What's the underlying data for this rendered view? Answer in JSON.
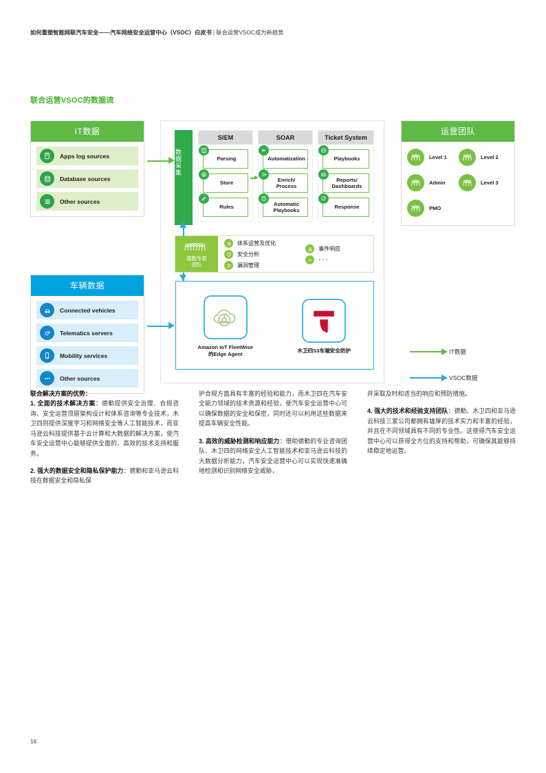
{
  "header": {
    "title_bold": "如何重塑智能网联汽车安全——汽车网络安全运营中心（VSOC）白皮书",
    "separator": "|",
    "subtitle": "联合运营VSOC成为新趋势"
  },
  "section_title": "联合运营VSOC的数据流",
  "diagram": {
    "it_panel": {
      "title": "IT数据",
      "items": [
        {
          "label": "Apps log sources",
          "icon": "device-icon"
        },
        {
          "label": "Database sources",
          "icon": "database-icon"
        },
        {
          "label": "Other sources",
          "icon": "list-icon"
        }
      ]
    },
    "vehicle_panel": {
      "title": "车辆数据",
      "items": [
        {
          "label": "Connected vehicles",
          "icon": "car-icon"
        },
        {
          "label": "Telematics servers",
          "icon": "satellite-icon"
        },
        {
          "label": "Mobility services",
          "icon": "mobile-icon"
        },
        {
          "label": "Other sources",
          "icon": "ellipsis-icon"
        }
      ]
    },
    "ops_panel": {
      "title": "运营团队",
      "members": [
        {
          "label": "Level 1",
          "icon": "people-icon"
        },
        {
          "label": "Level 2",
          "icon": "people-icon"
        },
        {
          "label": "Admin",
          "icon": "people-icon"
        },
        {
          "label": "Level 3",
          "icon": "people-icon"
        },
        {
          "label": "PMO",
          "icon": "people-icon"
        }
      ]
    },
    "collection_bar": "数据采集",
    "tool_columns": [
      {
        "head": "SIEM",
        "items": [
          {
            "label": "Parsing",
            "icon": "parse-icon"
          },
          {
            "label": "Store",
            "icon": "store-icon"
          },
          {
            "label": "Rules",
            "icon": "rules-icon"
          }
        ]
      },
      {
        "head": "SOAR",
        "items": [
          {
            "label": "Automatization",
            "icon": "automation-icon"
          },
          {
            "label": "Enrich/ Process",
            "icon": "enrich-icon"
          },
          {
            "label": "Automatic Playbooks",
            "icon": "playbook-icon"
          }
        ]
      },
      {
        "head": "Ticket System",
        "items": [
          {
            "label": "Playbooks",
            "icon": "book-icon"
          },
          {
            "label": "Reports/ Dashboards",
            "icon": "report-icon"
          },
          {
            "label": "Response",
            "icon": "response-icon"
          }
        ]
      }
    ],
    "expert_team": {
      "title_line1": "德勤专家",
      "title_line2": "团队",
      "icon": "people-group-icon",
      "services_col1": [
        {
          "label": "体系运营及优化",
          "icon": "gear-icon"
        },
        {
          "label": "安全分析",
          "icon": "shield-icon"
        },
        {
          "label": "漏洞管理",
          "icon": "bug-icon"
        }
      ],
      "services_col2": [
        {
          "label": "事件响应",
          "icon": "alert-icon"
        },
        {
          "label": "···",
          "icon": "ellipsis-icon"
        }
      ]
    },
    "logos": [
      {
        "caption_line1": "Amazon IoT FleetWise",
        "caption_line2": "的Edge Agent",
        "icon": "fleetwise-cloud-icon"
      },
      {
        "caption_line1": "木卫四S3车端安全防护",
        "caption_line2": "",
        "icon": "callisto-shield-icon"
      }
    ],
    "legend": [
      {
        "label": "IT数据",
        "color": "#62bb46"
      },
      {
        "label": "VSOC数据",
        "color": "#27a9e1"
      }
    ]
  },
  "body": {
    "col1": {
      "heading": "联合解决方案的优势：",
      "p1_lead": "1. 全面的技术解决方案",
      "p1_text": "：德勤提供安全治理、合规咨询、安全运营顶层架构设计和体系咨询等专业技术，木卫四则提供深度学习和网络安全等人工智能技术，而亚马逊云科技提供基于云计算和大数据的解决方案，使汽车安全运营中心能够提供全面的、高效的技术支持和服务。",
      "p2_lead": "2. 强大的数据安全和隐私保护能力",
      "p2_text": "：德勤和亚马逊云科技在数据安全和隐私保"
    },
    "col2": {
      "p1_text": "护合规方面具有丰富的经验和能力，而木卫四在汽车安全能力领域的技术资源和经验，使汽车安全运营中心可以确保数据的安全和保密，同时还可以利用这些数据来提高车辆安全性能。",
      "p2_lead": "3. 高效的威胁检测和响应能力",
      "p2_text": "：借助德勤的专业咨询团队、木卫四的网络安全人工智能技术和亚马逊云科技的大数据分析能力，汽车安全运营中心可以实现快速准确地检测和识别网络安全威胁，"
    },
    "col3": {
      "p1_text": "并采取及时和适当的响应和预防措施。",
      "p2_lead": "4. 强大的技术和经验支持团队",
      "p2_text": "：德勤、木卫四和亚马逊云科技三家公司都拥有雄厚的技术实力和丰富的经验，并且在不同领域具有不同的专业性。这使得汽车安全运营中心可以获得全方位的支持和帮助，可确保其能够持续稳定地运营。"
    }
  },
  "page_number": "16"
}
